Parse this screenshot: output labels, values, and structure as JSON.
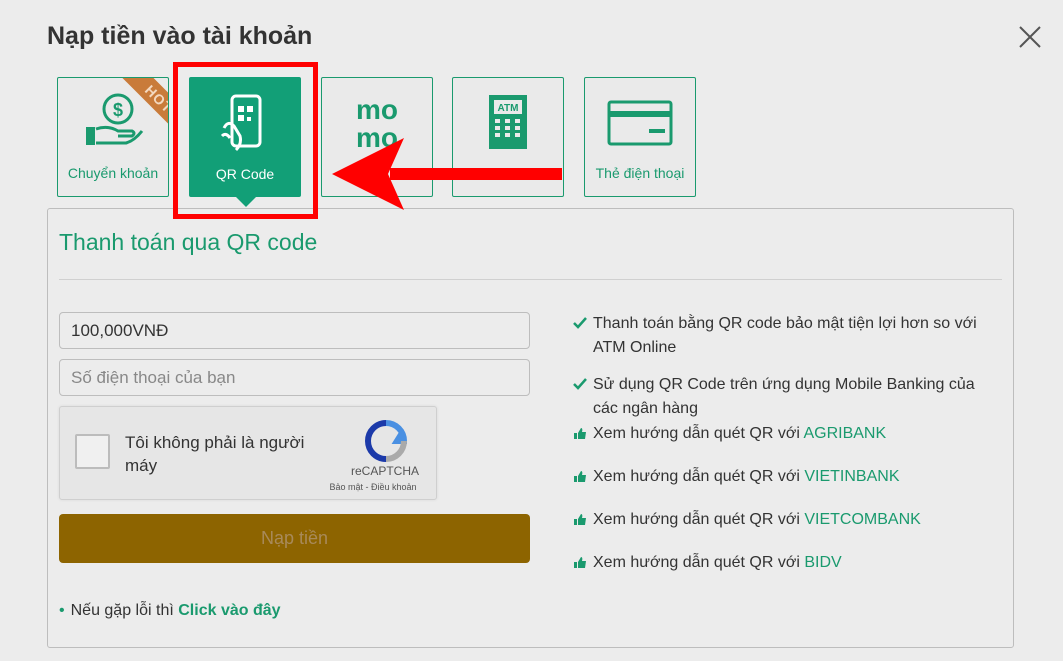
{
  "dialog": {
    "title": "Nạp tiền vào tài khoản"
  },
  "tabs": [
    {
      "label": "Chuyển khoản",
      "icon": "hand-money-icon",
      "badge": "HOT"
    },
    {
      "label": "QR Code",
      "icon": "phone-qr-icon",
      "selected": true
    },
    {
      "label": "",
      "icon": "momo-icon",
      "logo_text": [
        "mo",
        "mo"
      ]
    },
    {
      "label": "",
      "icon": "atm-icon",
      "logo_text": "ATM"
    },
    {
      "label": "Thẻ điện thoại",
      "icon": "card-icon"
    }
  ],
  "panel": {
    "title": "Thanh toán qua QR code",
    "amount_value": "100,000VNĐ",
    "phone_placeholder": "Số điện thoại của bạn",
    "captcha": {
      "label": "Tôi không phải là người máy",
      "brand": "reCAPTCHA",
      "terms": "Bảo mật - Điều khoản"
    },
    "submit_label": "Nạp tiền",
    "error_note": {
      "prefix": "Nếu gặp lỗi thì",
      "link": "Click vào đây"
    }
  },
  "info": {
    "points": [
      "Thanh toán bằng QR code bảo mật tiện lợi hơn so với ATM Online",
      "Sử dụng QR Code trên ứng dụng Mobile Banking của các ngân hàng"
    ],
    "guide_prefix": "Xem hướng dẫn quét QR với",
    "banks": [
      "AGRIBANK",
      "VIETINBANK",
      "VIETCOMBANK",
      "BIDV"
    ]
  },
  "colors": {
    "accent": "#1a9a6e",
    "selected_tab": "#129f77",
    "submit_button": "#8d6400",
    "highlight": "#ff0000"
  }
}
